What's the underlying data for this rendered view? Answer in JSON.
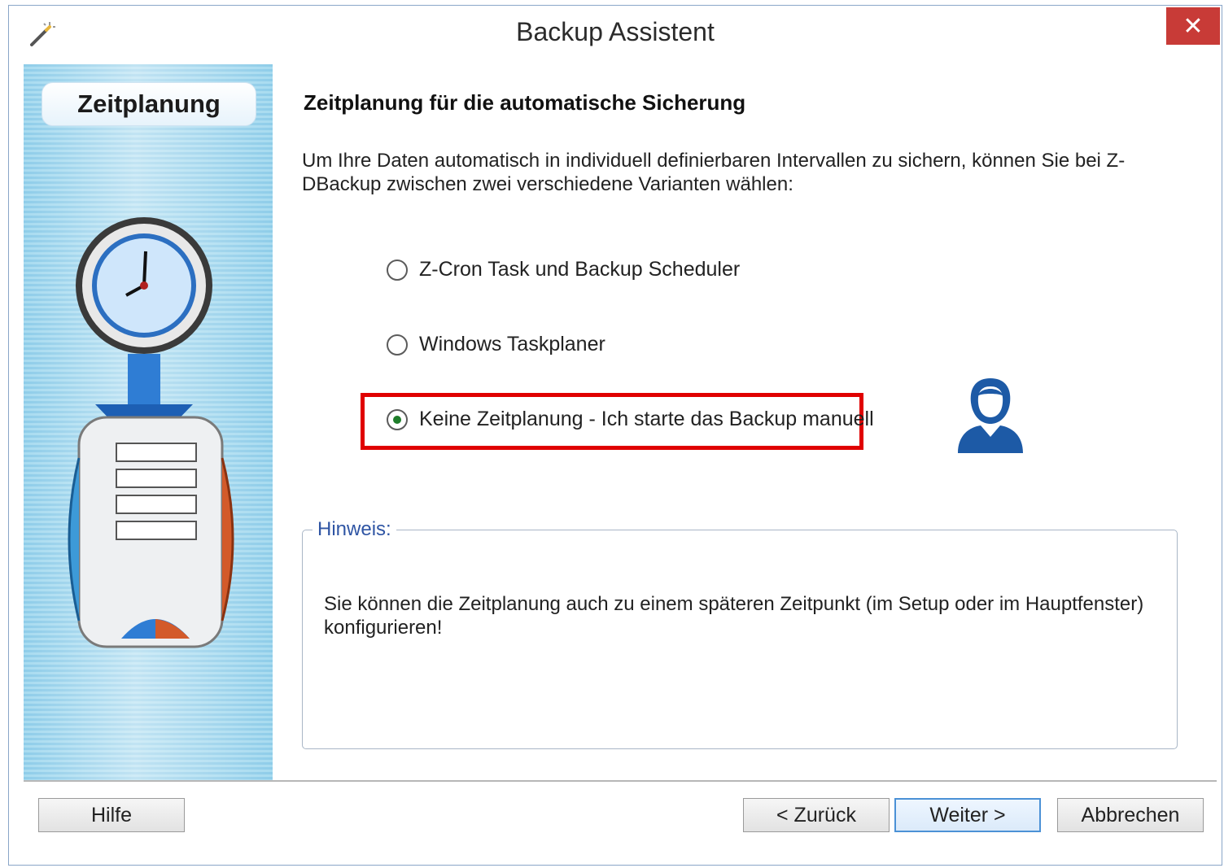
{
  "window": {
    "title": "Backup Assistent"
  },
  "sidebar": {
    "step_label": "Zeitplanung"
  },
  "main": {
    "heading": "Zeitplanung für die automatische Sicherung",
    "intro": "Um Ihre Daten automatisch in individuell definierbaren Intervallen zu sichern, können Sie bei Z-DBackup zwischen zwei verschiedene Varianten wählen:",
    "options": [
      {
        "label": "Z-Cron Task und Backup Scheduler",
        "selected": false
      },
      {
        "label": "Windows Taskplaner",
        "selected": false
      },
      {
        "label": "Keine Zeitplanung - Ich starte das Backup manuell",
        "selected": true
      }
    ],
    "hint": {
      "legend": "Hinweis:",
      "text": "Sie können die Zeitplanung auch zu einem späteren Zeitpunkt (im Setup oder im Hauptfenster) konfigurieren!"
    }
  },
  "footer": {
    "help": "Hilfe",
    "back": "< Zurück",
    "next": "Weiter >",
    "cancel": "Abbrechen"
  },
  "icons": {
    "app": "wand-icon",
    "close": "close-icon",
    "sidebar_art": "clock-backup-icon",
    "person": "user-icon"
  },
  "colors": {
    "close": "#c83b37",
    "highlight": "#e00000",
    "accent": "#2f55a4"
  }
}
